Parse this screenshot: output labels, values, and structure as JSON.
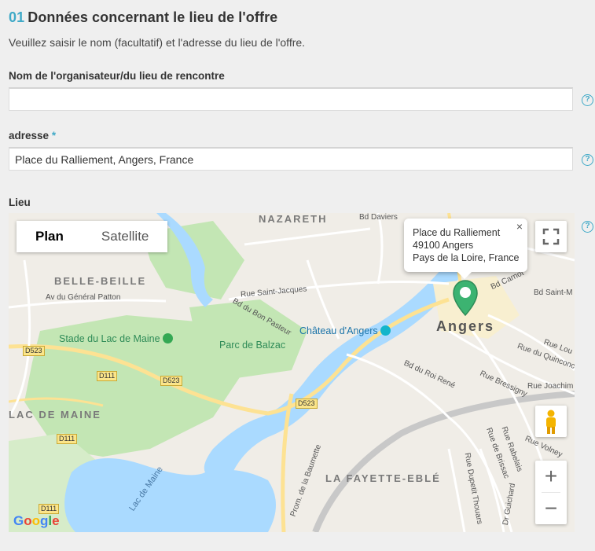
{
  "section": {
    "number": "01",
    "title": "Données concernant le lieu de l'offre",
    "intro": "Veuillez saisir le nom (facultatif) et l'adresse du lieu de l'offre."
  },
  "fields": {
    "organizer": {
      "label": "Nom de l'organisateur/du lieu de rencontre",
      "value": ""
    },
    "address": {
      "label": "adresse",
      "required_mark": "*",
      "value": "Place du Ralliement, Angers, France"
    },
    "location": {
      "label": "Lieu"
    }
  },
  "help_icon": "?",
  "map": {
    "type_buttons": {
      "plan": "Plan",
      "satellite": "Satellite"
    },
    "selected_type": "Plan",
    "info_window": {
      "line1": "Place du Ralliement",
      "line2": "49100 Angers",
      "line3": "Pays de la Loire, France",
      "close": "×"
    },
    "zoom_in": "+",
    "zoom_out": "−",
    "labels": {
      "nazareth": "NAZARETH",
      "belle_beille": "BELLE-BEILLE",
      "lac_de_maine_district": "LAC DE MAINE",
      "la_fayette": "LA FAYETTE-EBLÉ",
      "angers": "Angers",
      "chateau": "Château d'Angers",
      "stade": "Stade du Lac de Maine",
      "parc": "Parc de Balzac",
      "lac": "Lac de Maine",
      "bd_daviers": "Bd Daviers",
      "rue_st_jacques": "Rue Saint-Jacques",
      "av_patton": "Av du Général Patton",
      "bd_bon_pasteur": "Bd du Bon Pasteur",
      "bd_roi_rene": "Bd du Roi René",
      "rue_bressigny": "Rue Bressigny",
      "bd_joachim": "Rue Joachim",
      "rue_quinconce": "Rue du Quinconce",
      "rue_volney": "Rue Volney",
      "rue_brissac": "Rue de Brissac",
      "rue_rabelais": "Rue Rabelais",
      "rue_dupetit": "Rue Dupetit Thouars",
      "dr_guichard": "Dr Guichard",
      "prom_baumette": "Prom. de la Baumette",
      "bd_carnot": "Bd Carnot",
      "bd_saint": "Bd Saint-M",
      "rue_lou": "Rue Lou",
      "d523": "D523",
      "d111": "D111"
    },
    "logo": "Google",
    "colors": {
      "water": "#aadaff",
      "park": "#c3e6b4",
      "road_major": "#fde293",
      "accent": "#3fa9c7"
    }
  }
}
